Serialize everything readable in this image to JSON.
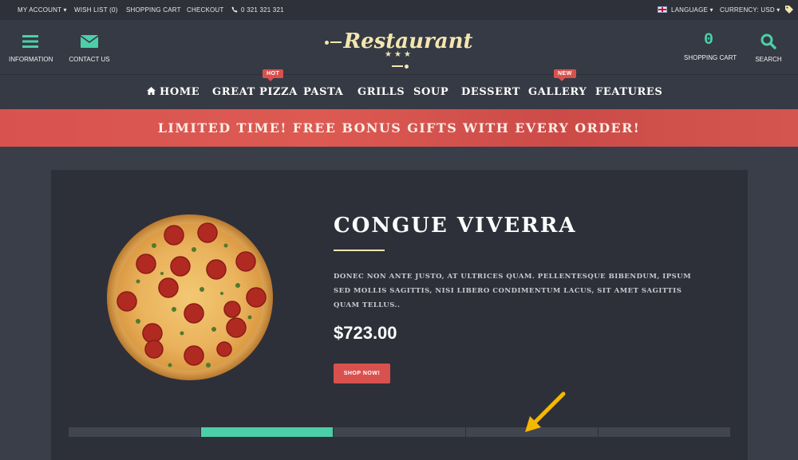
{
  "topbar": {
    "my_account": "MY ACCOUNT",
    "wish_list": "WISH LIST (0)",
    "shopping_cart": "SHOPPING CART",
    "checkout": "CHECKOUT",
    "phone": "0 321 321 321",
    "language": "LANGUAGE",
    "currency": "CURRENCY: USD"
  },
  "header": {
    "information": "INFORMATION",
    "contact_us": "CONTACT US",
    "logo": "Restaurant",
    "stars": "★★★",
    "cart_count": "0",
    "shopping_cart": "SHOPPING CART",
    "search": "SEARCH"
  },
  "nav": {
    "home": "HOME",
    "great_pizza": "GREAT PIZZA",
    "pasta": "PASTA",
    "grills": "GRILLS",
    "soup": "SOUP",
    "dessert": "DESSERT",
    "gallery": "GALLERY",
    "features": "FEATURES",
    "badge_hot": "HOT",
    "badge_new": "NEW"
  },
  "promo": "LIMITED TIME! FREE BONUS GIFTS WITH EVERY ORDER!",
  "product": {
    "title": "CONGUE VIVERRA",
    "description": "DONEC NON ANTE JUSTO, AT ULTRICES QUAM. PELLENTESQUE BIBENDUM, IPSUM SED MOLLIS SAGITTIS, NISI LIBERO CONDIMENTUM LACUS, SIT AMET SAGITTIS QUAM TELLUS..",
    "price": "$723.00",
    "shop_now": "SHOP NOW!"
  },
  "slider": {
    "count": 5,
    "active_index": 1
  },
  "colors": {
    "accent": "#4ccfa8",
    "promo": "#d9514e",
    "logo": "#f4e6b0",
    "arrow": "#f5b800"
  }
}
